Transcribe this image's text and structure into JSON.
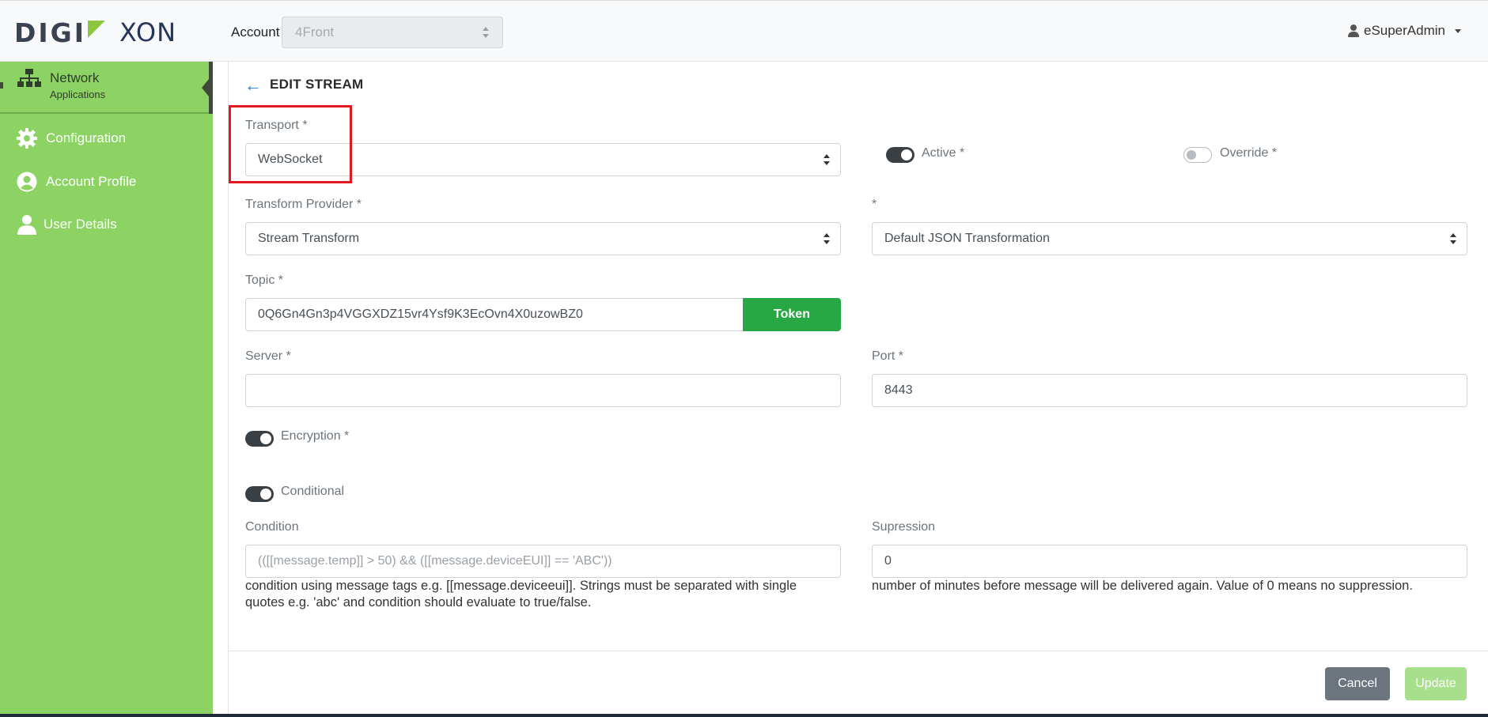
{
  "header": {
    "logo_left": "DIGI",
    "logo_right": "XON",
    "account_label": "Account",
    "account_value": "4Front",
    "user_name": "eSuperAdmin"
  },
  "sidebar": {
    "active": {
      "title": "Network",
      "subtitle": "Applications",
      "icon": "network-icon"
    },
    "items": [
      {
        "label": "Configuration",
        "icon": "gear-icon"
      },
      {
        "label": "Account Profile",
        "icon": "account-circle-icon"
      },
      {
        "label": "User Details",
        "icon": "user-icon"
      }
    ]
  },
  "page": {
    "title": "EDIT STREAM",
    "transport": {
      "label": "Transport *",
      "value": "WebSocket"
    },
    "active": {
      "label": "Active *",
      "on": true
    },
    "override": {
      "label": "Override *",
      "on": false
    },
    "transform_provider": {
      "label": "Transform Provider *",
      "value": "Stream Transform"
    },
    "transformation": {
      "label": "*",
      "value": "Default JSON Transformation"
    },
    "topic": {
      "label": "Topic *",
      "value": "0Q6Gn4Gn3p4VGGXDZ15vr4Ysf9K3EcOvn4X0uzowBZ0",
      "button": "Token"
    },
    "server": {
      "label": "Server *",
      "value": ""
    },
    "port": {
      "label": "Port *",
      "value": "8443"
    },
    "encryption": {
      "label": "Encryption *",
      "on": true
    },
    "conditional": {
      "label": "Conditional",
      "on": true
    },
    "condition": {
      "label": "Condition",
      "placeholder": "(([[message.temp]] > 50) && ([[message.deviceEUI]] == 'ABC'))",
      "help_line1": "condition using message tags e.g. [[message.deviceeui]]. Strings must be separated with single",
      "help_line2": "quotes e.g. 'abc' and condition should evaluate to true/false."
    },
    "supression": {
      "label": "Supression",
      "value": "0",
      "help": "number of minutes before message will be delivered again. Value of 0 means no suppression."
    },
    "cancel_label": "Cancel",
    "update_label": "Update"
  },
  "colors": {
    "sidebar": "#8cd364",
    "token": "#28a745",
    "highlight": "#e3191f",
    "update": "#a7df8c",
    "cancel": "#6c757d"
  }
}
